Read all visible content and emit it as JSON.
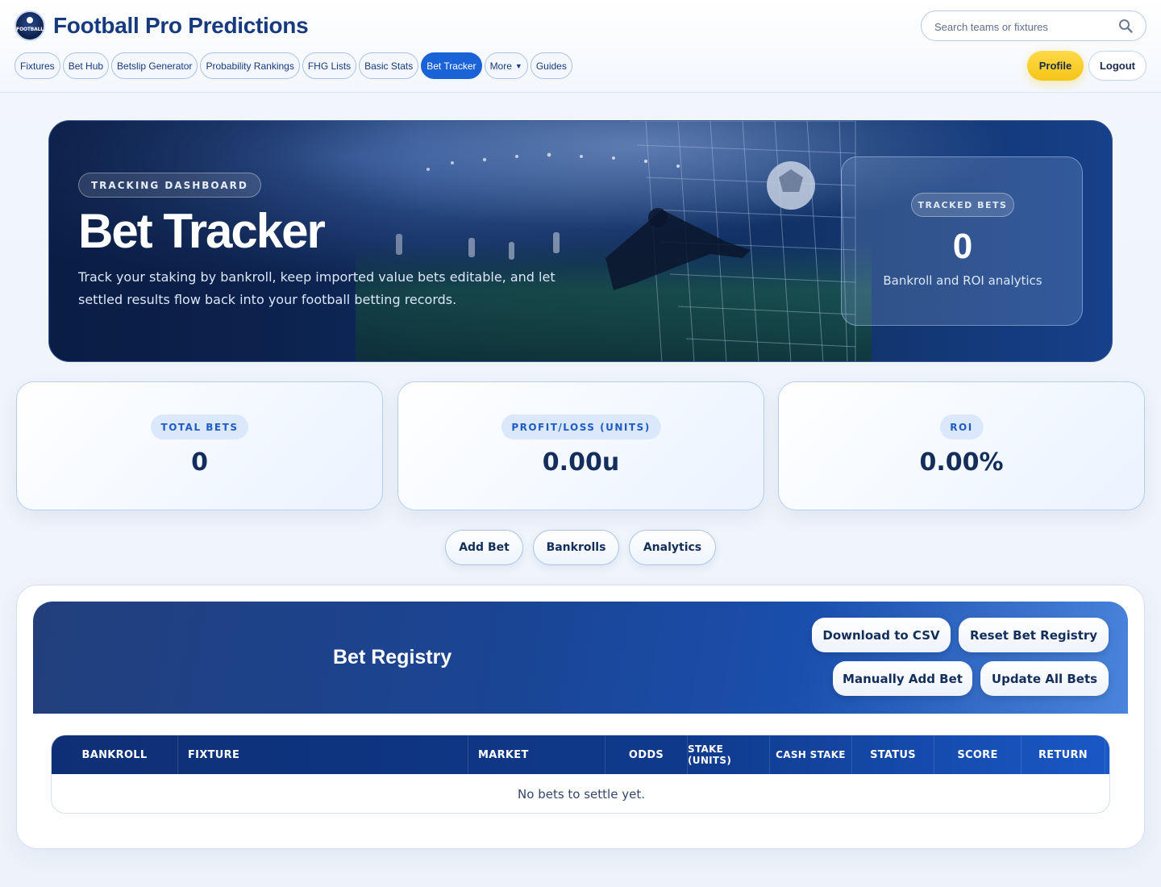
{
  "header": {
    "logo_text": "FOOTBALL",
    "brand": "Football Pro Predictions",
    "search_placeholder": "Search teams or fixtures",
    "nav": [
      {
        "label": "Fixtures"
      },
      {
        "label": "Bet Hub"
      },
      {
        "label": "Betslip Generator"
      },
      {
        "label": "Probability Rankings"
      },
      {
        "label": "FHG Lists"
      },
      {
        "label": "Basic Stats"
      },
      {
        "label": "Bet Tracker",
        "active": true
      },
      {
        "label": "More"
      },
      {
        "label": "Guides"
      }
    ],
    "profile_label": "Profile",
    "logout_label": "Logout"
  },
  "hero": {
    "badge": "TRACKING DASHBOARD",
    "title": "Bet Tracker",
    "description": "Track your staking by bankroll, keep imported value bets editable, and let settled results flow back into your football betting records.",
    "card": {
      "badge": "TRACKED BETS",
      "value": "0",
      "subtitle": "Bankroll and ROI analytics"
    }
  },
  "stats": [
    {
      "label": "TOTAL BETS",
      "value": "0"
    },
    {
      "label": "PROFIT/LOSS (UNITS)",
      "value": "0.00u"
    },
    {
      "label": "ROI",
      "value": "0.00%"
    }
  ],
  "actions": {
    "add_bet": "Add Bet",
    "bankrolls": "Bankrolls",
    "analytics": "Analytics"
  },
  "registry": {
    "title": "Bet Registry",
    "download_csv": "Download to CSV",
    "reset": "Reset Bet Registry",
    "manual_add": "Manually Add Bet",
    "update_all": "Update All Bets",
    "columns": [
      "BANKROLL",
      "FIXTURE",
      "MARKET",
      "ODDS",
      "STAKE (UNITS)",
      "CASH STAKE",
      "STATUS",
      "SCORE",
      "RETURN"
    ],
    "empty_message": "No bets to settle yet."
  },
  "colors": {
    "accent": "#1a63d6",
    "profile": "#f5c518",
    "brand_text": "#163a7d"
  }
}
